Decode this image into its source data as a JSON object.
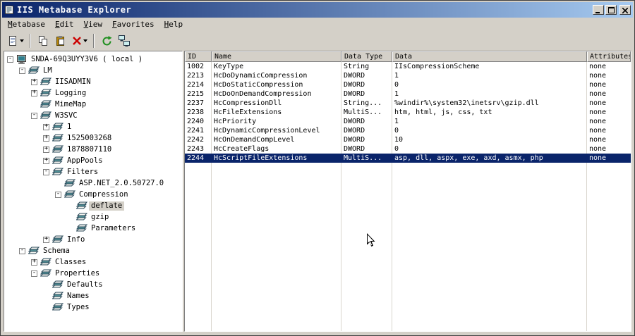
{
  "window": {
    "title": "IIS Metabase Explorer",
    "app_icon": "metabase-app-icon",
    "controls": [
      "minimize",
      "maximize",
      "close"
    ]
  },
  "menu_bar": {
    "items": [
      "Metabase",
      "Edit",
      "View",
      "Favorites",
      "Help"
    ]
  },
  "toolbar": {
    "buttons": [
      {
        "name": "new-key-button",
        "icon": "new-page-icon",
        "dropdown": true
      },
      {
        "name": "separator"
      },
      {
        "name": "copy-button",
        "icon": "copy-icon"
      },
      {
        "name": "paste-button",
        "icon": "paste-icon"
      },
      {
        "name": "delete-button",
        "icon": "delete-red-x-icon",
        "dropdown": true
      },
      {
        "name": "separator"
      },
      {
        "name": "refresh-button",
        "icon": "refresh-icon"
      },
      {
        "name": "connect-button",
        "icon": "network-icon"
      }
    ]
  },
  "tree": {
    "items": [
      {
        "label": "SNDA-69Q3UYY3V6 ( local )",
        "depth": 0,
        "expander": "minus",
        "icon": "computer",
        "selected": false
      },
      {
        "label": "LM",
        "depth": 1,
        "expander": "minus",
        "icon": "node",
        "selected": false
      },
      {
        "label": "IISADMIN",
        "depth": 2,
        "expander": "plus",
        "icon": "node",
        "selected": false
      },
      {
        "label": "Logging",
        "depth": 2,
        "expander": "plus",
        "icon": "node",
        "selected": false
      },
      {
        "label": "MimeMap",
        "depth": 2,
        "expander": "none",
        "icon": "node",
        "selected": false
      },
      {
        "label": "W3SVC",
        "depth": 2,
        "expander": "minus",
        "icon": "node",
        "selected": false
      },
      {
        "label": "1",
        "depth": 3,
        "expander": "plus",
        "icon": "node",
        "selected": false
      },
      {
        "label": "1525003268",
        "depth": 3,
        "expander": "plus",
        "icon": "node",
        "selected": false
      },
      {
        "label": "1878807110",
        "depth": 3,
        "expander": "plus",
        "icon": "node",
        "selected": false
      },
      {
        "label": "AppPools",
        "depth": 3,
        "expander": "plus",
        "icon": "node",
        "selected": false
      },
      {
        "label": "Filters",
        "depth": 3,
        "expander": "minus",
        "icon": "node",
        "selected": false
      },
      {
        "label": "ASP.NET_2.0.50727.0",
        "depth": 4,
        "expander": "none",
        "icon": "node",
        "selected": false
      },
      {
        "label": "Compression",
        "depth": 4,
        "expander": "minus",
        "icon": "node",
        "selected": false
      },
      {
        "label": "deflate",
        "depth": 5,
        "expander": "none",
        "icon": "node",
        "selected": true
      },
      {
        "label": "gzip",
        "depth": 5,
        "expander": "none",
        "icon": "node",
        "selected": false
      },
      {
        "label": "Parameters",
        "depth": 5,
        "expander": "none",
        "icon": "node",
        "selected": false
      },
      {
        "label": "Info",
        "depth": 3,
        "expander": "plus",
        "icon": "node",
        "selected": false
      },
      {
        "label": "Schema",
        "depth": 1,
        "expander": "minus",
        "icon": "node",
        "selected": false
      },
      {
        "label": "Classes",
        "depth": 2,
        "expander": "plus",
        "icon": "node",
        "selected": false
      },
      {
        "label": "Properties",
        "depth": 2,
        "expander": "minus",
        "icon": "node",
        "selected": false
      },
      {
        "label": "Defaults",
        "depth": 3,
        "expander": "none",
        "icon": "node",
        "selected": false
      },
      {
        "label": "Names",
        "depth": 3,
        "expander": "none",
        "icon": "node",
        "selected": false
      },
      {
        "label": "Types",
        "depth": 3,
        "expander": "none",
        "icon": "node",
        "selected": false
      }
    ]
  },
  "table": {
    "columns": [
      "ID",
      "Name",
      "Data Type",
      "Data",
      "Attributes"
    ],
    "rows": [
      {
        "cells": [
          "1002",
          "KeyType",
          "String",
          "IIsCompressionScheme",
          "none"
        ],
        "selected": false
      },
      {
        "cells": [
          "2213",
          "HcDoDynamicCompression",
          "DWORD",
          "1",
          "none"
        ],
        "selected": false
      },
      {
        "cells": [
          "2214",
          "HcDoStaticCompression",
          "DWORD",
          "0",
          "none"
        ],
        "selected": false
      },
      {
        "cells": [
          "2215",
          "HcDoOnDemandCompression",
          "DWORD",
          "1",
          "none"
        ],
        "selected": false
      },
      {
        "cells": [
          "2237",
          "HcCompressionDll",
          "String...",
          "%windir%\\system32\\inetsrv\\gzip.dll",
          "none"
        ],
        "selected": false
      },
      {
        "cells": [
          "2238",
          "HcFileExtensions",
          "MultiS...",
          "htm, html, js, css, txt",
          "none"
        ],
        "selected": false
      },
      {
        "cells": [
          "2240",
          "HcPriority",
          "DWORD",
          "1",
          "none"
        ],
        "selected": false
      },
      {
        "cells": [
          "2241",
          "HcDynamicCompressionLevel",
          "DWORD",
          "0",
          "none"
        ],
        "selected": false
      },
      {
        "cells": [
          "2242",
          "HcOnDemandCompLevel",
          "DWORD",
          "10",
          "none"
        ],
        "selected": false
      },
      {
        "cells": [
          "2243",
          "HcCreateFlags",
          "DWORD",
          "0",
          "none"
        ],
        "selected": false
      },
      {
        "cells": [
          "2244",
          "HcScriptFileExtensions",
          "MultiS...",
          "asp, dll, aspx, exe, axd, asmx, php",
          "none"
        ],
        "selected": true
      }
    ]
  },
  "colors": {
    "titlebar_left": "#0a246a",
    "titlebar_right": "#a6caf0",
    "selection": "#0a246a",
    "window_bg": "#d4d0c8"
  }
}
